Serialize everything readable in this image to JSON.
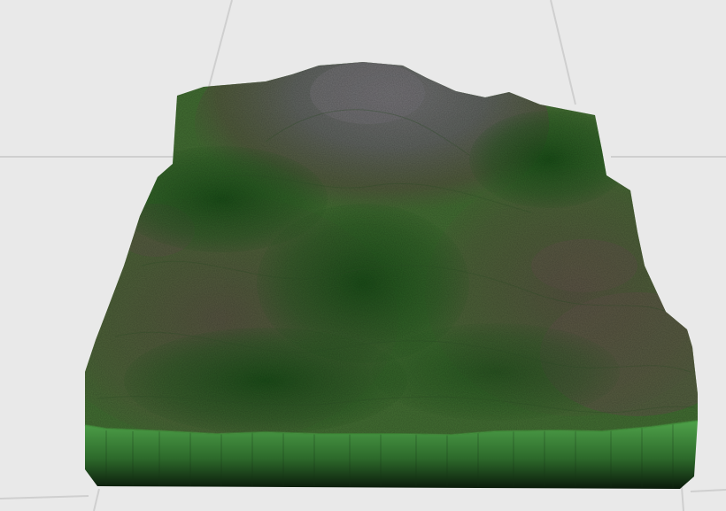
{
  "scene": {
    "background_color": "#e9e9e9",
    "grid_line_color": "#cfcfcf",
    "terrain": {
      "colors": {
        "grass_dark": "#2f7a2a",
        "grass_mid": "#4a9a3a",
        "grass_light": "#6f9a58",
        "dirt": "#7d6f5e",
        "rock": "#8e8a92",
        "rock_highlight": "#a6a2aa",
        "side_top": "#4fa24a",
        "side_bottom": "#0b1a0b"
      }
    }
  }
}
